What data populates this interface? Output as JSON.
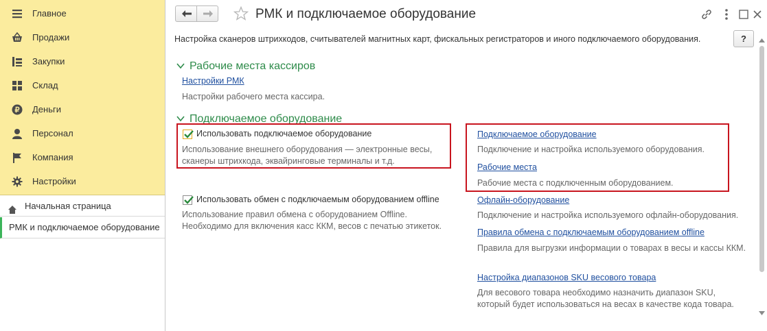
{
  "sidebar": {
    "sections": [
      {
        "label": "Главное",
        "icon": "menu-icon"
      },
      {
        "label": "Продажи",
        "icon": "basket-icon"
      },
      {
        "label": "Закупки",
        "icon": "purchase-icon"
      },
      {
        "label": "Склад",
        "icon": "warehouse-icon"
      },
      {
        "label": "Деньги",
        "icon": "money-icon"
      },
      {
        "label": "Персонал",
        "icon": "person-icon"
      },
      {
        "label": "Компания",
        "icon": "flag-icon"
      },
      {
        "label": "Настройки",
        "icon": "gear-icon"
      }
    ],
    "home": "Начальная страница",
    "current": "РМК и подключаемое оборудование"
  },
  "window": {
    "title": "РМК и подключаемое оборудование",
    "description": "Настройка сканеров штрихкодов, считывателей магнитных карт, фискальных регистраторов и иного подключаемого оборудования.",
    "help": "?"
  },
  "groups": {
    "cashier": {
      "title": "Рабочие места кассиров",
      "link": "Настройки РМК",
      "hint": "Настройки рабочего места кассира."
    },
    "equipment": {
      "title": "Подключаемое оборудование",
      "use_equipment": {
        "label": "Использовать подключаемое оборудование",
        "checked": true,
        "hint": "Использование внешнего оборудования — электронные весы, сканеры штрихкода, эквайринговые терминалы и т.д."
      },
      "use_offline": {
        "label": "Использовать обмен с подключаемым оборудованием offline",
        "checked": true,
        "hint": "Использование правил обмена с оборудованием Offline. Необходимо для включения касс ККМ, весов с печатью этикеток."
      },
      "links": [
        {
          "label": "Подключаемое оборудование",
          "hint": "Подключение и настройка используемого оборудования."
        },
        {
          "label": "Рабочие места",
          "hint": "Рабочие места с подключенным оборудованием."
        },
        {
          "label": "Офлайн-оборудование",
          "hint": "Подключение и настройка используемого офлайн-оборудования."
        },
        {
          "label": "Правила обмена с подключаемым оборудованием offline",
          "hint": "Правила для выгрузки информации о товарах в весы и кассы ККМ."
        },
        {
          "label": "Настройка диапазонов SKU весового товара",
          "hint": "Для весового товара необходимо назначить диапазон SKU, который будет использоваться на весах в качестве кода товара."
        }
      ]
    }
  },
  "colors": {
    "sidebar_bg": "#fbec9e",
    "group_title": "#2e8b4a",
    "link": "#1f4f9f",
    "highlight": "#c8141e",
    "active_marker": "#3cb45a"
  }
}
